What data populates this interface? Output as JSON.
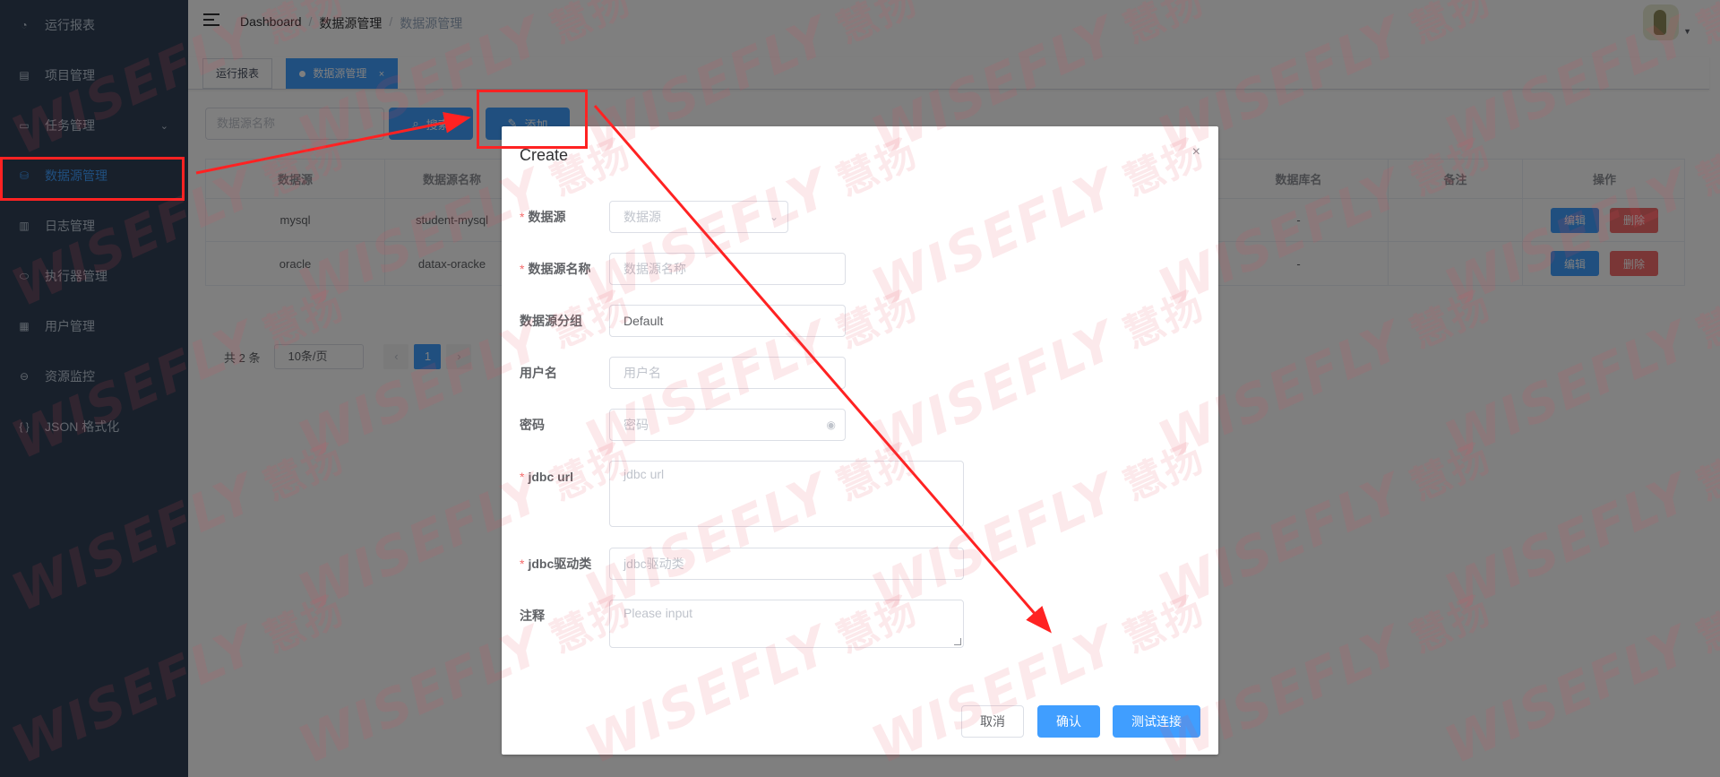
{
  "sidebar": {
    "items": [
      {
        "label": "运行报表",
        "icon": "dashboard-icon",
        "active": false
      },
      {
        "label": "项目管理",
        "icon": "project-icon",
        "active": false
      },
      {
        "label": "任务管理",
        "icon": "task-icon",
        "active": false,
        "has_submenu": true
      },
      {
        "label": "数据源管理",
        "icon": "database-icon",
        "active": true
      },
      {
        "label": "日志管理",
        "icon": "log-icon",
        "active": false
      },
      {
        "label": "执行器管理",
        "icon": "executor-icon",
        "active": false
      },
      {
        "label": "用户管理",
        "icon": "user-table-icon",
        "active": false
      },
      {
        "label": "资源监控",
        "icon": "monitor-icon",
        "active": false
      },
      {
        "label": "JSON 格式化",
        "icon": "json-icon",
        "active": false
      }
    ]
  },
  "navbar": {
    "breadcrumb": [
      "Dashboard",
      "数据源管理",
      "数据源管理"
    ]
  },
  "tags": [
    {
      "label": "运行报表",
      "active": false
    },
    {
      "label": "数据源管理",
      "active": true,
      "close": "×"
    }
  ],
  "toolbar": {
    "search_placeholder": "数据源名称",
    "search_label": "搜索",
    "add_label": "添加"
  },
  "table": {
    "columns": [
      "数据源",
      "数据源名称",
      "数据库名",
      "备注",
      "操作"
    ],
    "rows": [
      {
        "source": "mysql",
        "name": "student-mysql",
        "db": "-",
        "remark": "",
        "edit": "编辑",
        "delete": "删除"
      },
      {
        "source": "oracle",
        "name": "datax-oracke",
        "db": "-",
        "remark": "",
        "edit": "编辑",
        "delete": "删除"
      }
    ]
  },
  "pagination": {
    "total_text": "共 2 条",
    "page_size": "10条/页",
    "current_page": "1"
  },
  "dialog": {
    "title": "Create",
    "close": "×",
    "fields": {
      "source": {
        "label": "数据源",
        "placeholder": "数据源",
        "required": true
      },
      "name": {
        "label": "数据源名称",
        "placeholder": "数据源名称",
        "required": true
      },
      "group": {
        "label": "数据源分组",
        "value": "Default",
        "required": false
      },
      "username": {
        "label": "用户名",
        "placeholder": "用户名",
        "required": false
      },
      "password": {
        "label": "密码",
        "placeholder": "密码",
        "required": false
      },
      "jdbc_url": {
        "label": "jdbc url",
        "placeholder": "jdbc url",
        "required": true
      },
      "jdbc_driver": {
        "label": "jdbc驱动类",
        "placeholder": "jdbc驱动类",
        "required": true
      },
      "comment": {
        "label": "注释",
        "placeholder": "Please input",
        "required": false
      }
    },
    "buttons": {
      "cancel": "取消",
      "confirm": "确认",
      "test": "测试连接"
    }
  },
  "watermark": {
    "text": "WISEFLY",
    "text_cn": "慧扬"
  },
  "colors": {
    "sidebar_bg": "#304156",
    "primary": "#409eff",
    "danger": "#f56c6c",
    "annotation": "#ff2222"
  }
}
